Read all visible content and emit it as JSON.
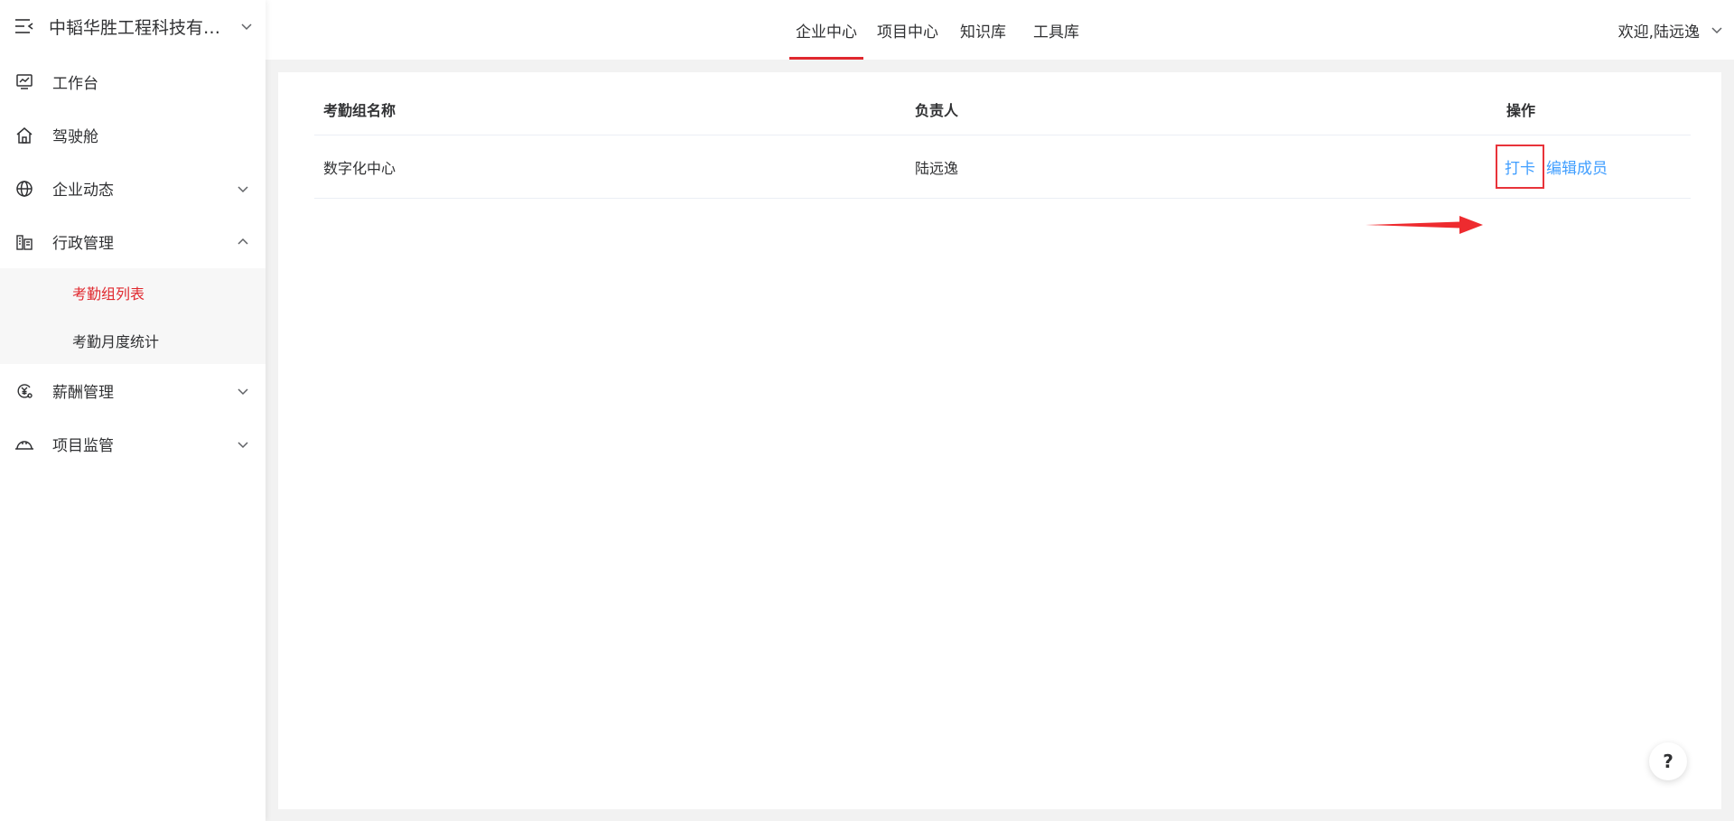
{
  "sidebar": {
    "company": "中韬华胜工程科技有限...",
    "items": [
      {
        "label": "工作台",
        "icon": "monitor-chart-icon"
      },
      {
        "label": "驾驶舱",
        "icon": "home-icon"
      },
      {
        "label": "企业动态",
        "icon": "globe-icon"
      },
      {
        "label": "行政管理",
        "icon": "building-icon"
      },
      {
        "label": "薪酬管理",
        "icon": "salary-icon"
      },
      {
        "label": "项目监管",
        "icon": "helmet-icon"
      }
    ],
    "admin_submenu": [
      {
        "label": "考勤组列表",
        "active": true
      },
      {
        "label": "考勤月度统计",
        "active": false
      }
    ]
  },
  "topnav": {
    "tabs": [
      "企业中心",
      "项目中心",
      "知识库",
      "工具库"
    ],
    "active_tab": "企业中心",
    "welcome": "欢迎,陆远逸"
  },
  "table": {
    "headers": [
      "考勤组名称",
      "负责人",
      "操作"
    ],
    "rows": [
      {
        "name": "数字化中心",
        "owner": "陆远逸",
        "actions": [
          "打卡",
          "编辑成员"
        ]
      }
    ]
  },
  "help_label": "?",
  "colors": {
    "accent": "#e0282e",
    "link": "#409eff",
    "highlight_box": "#e8333a"
  }
}
